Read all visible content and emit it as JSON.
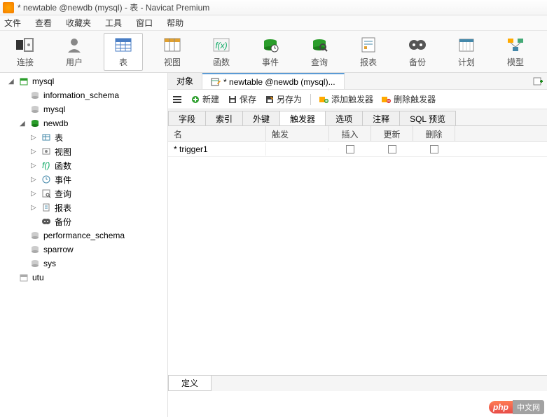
{
  "title": "* newtable @newdb (mysql) - 表 - Navicat Premium",
  "menu": [
    "文件",
    "查看",
    "收藏夹",
    "工具",
    "窗口",
    "帮助"
  ],
  "toolbar": [
    {
      "name": "connect",
      "label": "连接"
    },
    {
      "name": "user",
      "label": "用户"
    },
    {
      "name": "table",
      "label": "表",
      "active": true
    },
    {
      "name": "view",
      "label": "视图"
    },
    {
      "name": "function",
      "label": "函数"
    },
    {
      "name": "event",
      "label": "事件"
    },
    {
      "name": "query",
      "label": "查询"
    },
    {
      "name": "report",
      "label": "报表"
    },
    {
      "name": "backup",
      "label": "备份"
    },
    {
      "name": "plan",
      "label": "计划"
    },
    {
      "name": "model",
      "label": "模型"
    }
  ],
  "tree": [
    {
      "lvl": 1,
      "name": "mysql",
      "icon": "server",
      "exp": "◢"
    },
    {
      "lvl": 2,
      "name": "information_schema",
      "icon": "db"
    },
    {
      "lvl": 2,
      "name": "mysql",
      "icon": "db"
    },
    {
      "lvl": 2,
      "name": "newdb",
      "icon": "db-open",
      "exp": "◢"
    },
    {
      "lvl": 3,
      "name": "表",
      "icon": "table",
      "exp": "▷"
    },
    {
      "lvl": 3,
      "name": "视图",
      "icon": "view",
      "exp": "▷"
    },
    {
      "lvl": 3,
      "name": "函数",
      "icon": "fx",
      "exp": "▷"
    },
    {
      "lvl": 3,
      "name": "事件",
      "icon": "event",
      "exp": "▷"
    },
    {
      "lvl": 3,
      "name": "查询",
      "icon": "query",
      "exp": "▷"
    },
    {
      "lvl": 3,
      "name": "报表",
      "icon": "report",
      "exp": "▷"
    },
    {
      "lvl": 3,
      "name": "备份",
      "icon": "backup",
      "exp": ""
    },
    {
      "lvl": 2,
      "name": "performance_schema",
      "icon": "db"
    },
    {
      "lvl": 2,
      "name": "sparrow",
      "icon": "db"
    },
    {
      "lvl": 2,
      "name": "sys",
      "icon": "db"
    },
    {
      "lvl": 1,
      "name": "utu",
      "icon": "server-off",
      "exp": ""
    }
  ],
  "tabs": {
    "items": [
      {
        "label": "对象",
        "active": false
      },
      {
        "label": "* newtable @newdb (mysql)...",
        "active": true,
        "icon": "table-edit"
      }
    ]
  },
  "actions": {
    "new": "新建",
    "save": "保存",
    "saveas": "另存为",
    "add_trigger": "添加触发器",
    "del_trigger": "删除触发器"
  },
  "subtabs": [
    "字段",
    "索引",
    "外键",
    "触发器",
    "选项",
    "注释",
    "SQL 预览"
  ],
  "subtab_active": 3,
  "grid": {
    "headers": {
      "name": "名",
      "trigger": "触发",
      "insert": "插入",
      "update": "更新",
      "delete": "删除"
    },
    "rows": [
      {
        "mark": "*",
        "name": "trigger1",
        "trigger": "",
        "insert": false,
        "update": false,
        "delete": false
      }
    ]
  },
  "bottom_tab": "定义",
  "watermark": {
    "brand": "php",
    "text": "中文网"
  }
}
